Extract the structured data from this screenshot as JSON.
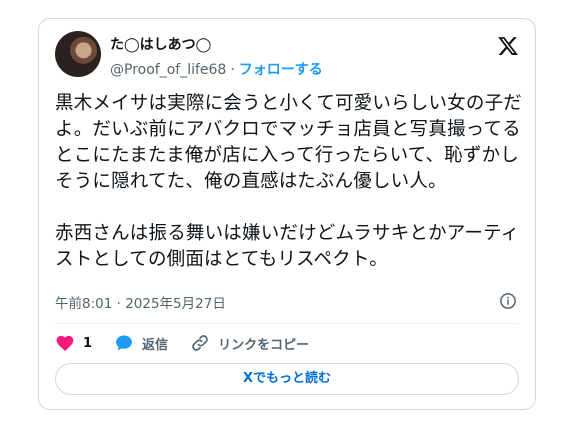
{
  "user": {
    "display_name": "た◯はしあつ◯",
    "handle": "@Proof_of_life68",
    "separator": "·",
    "follow_label": "フォローする"
  },
  "tweet": {
    "text": "黒木メイサは実際に会うと小くて可愛いらしい女の子だよ。だいぶ前にアバクロでマッチョ店員と写真撮ってるとこにたまたま俺が店に入って行ったらいて、恥ずかしそうに隠れてた、俺の直感はたぶん優しい人。\n\n赤西さんは振る舞いは嫌いだけどムラサキとかアーティストとしての側面はとてもリスペクト。",
    "timestamp": "午前8:01 · 2025年5月27日"
  },
  "actions": {
    "like_count": "1",
    "reply_label": "返信",
    "copy_link_label": "リンクをコピー"
  },
  "read_more_label": "Xでもっと読む",
  "colors": {
    "accent": "#1d9bf0",
    "like": "#f91880",
    "muted": "#536471"
  }
}
